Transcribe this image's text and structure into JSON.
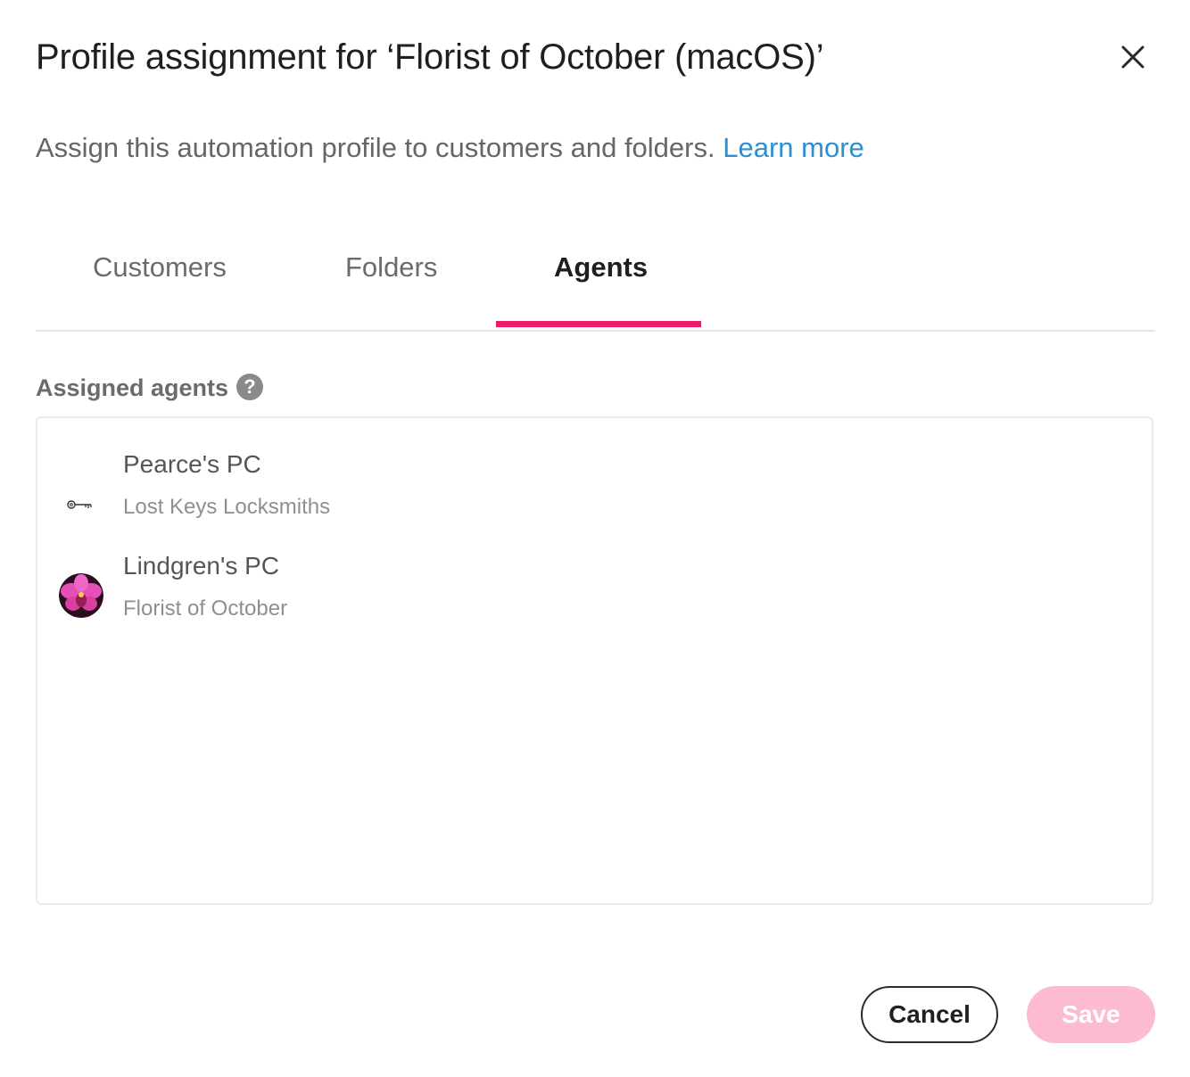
{
  "dialog": {
    "title": "Profile assignment for ‘Florist of October (macOS)’",
    "subtitle": "Assign this automation profile to customers and folders.",
    "learn_more": "Learn more"
  },
  "tabs": [
    {
      "label": "Customers",
      "active": false
    },
    {
      "label": "Folders",
      "active": false
    },
    {
      "label": "Agents",
      "active": true
    }
  ],
  "accent_color": "#f0196b",
  "link_color": "#2a8fd6",
  "section": {
    "label": "Assigned agents",
    "help_icon": "question-circle-icon",
    "help_glyph": "?"
  },
  "agents": [
    {
      "name": "Pearce's PC",
      "customer": "Lost Keys Locksmiths",
      "avatar": "key-icon"
    },
    {
      "name": "Lindgren's PC",
      "customer": "Florist of October",
      "avatar": "orchid-avatar"
    }
  ],
  "footer": {
    "cancel_label": "Cancel",
    "save_label": "Save",
    "save_color": "#fdbbd2"
  }
}
